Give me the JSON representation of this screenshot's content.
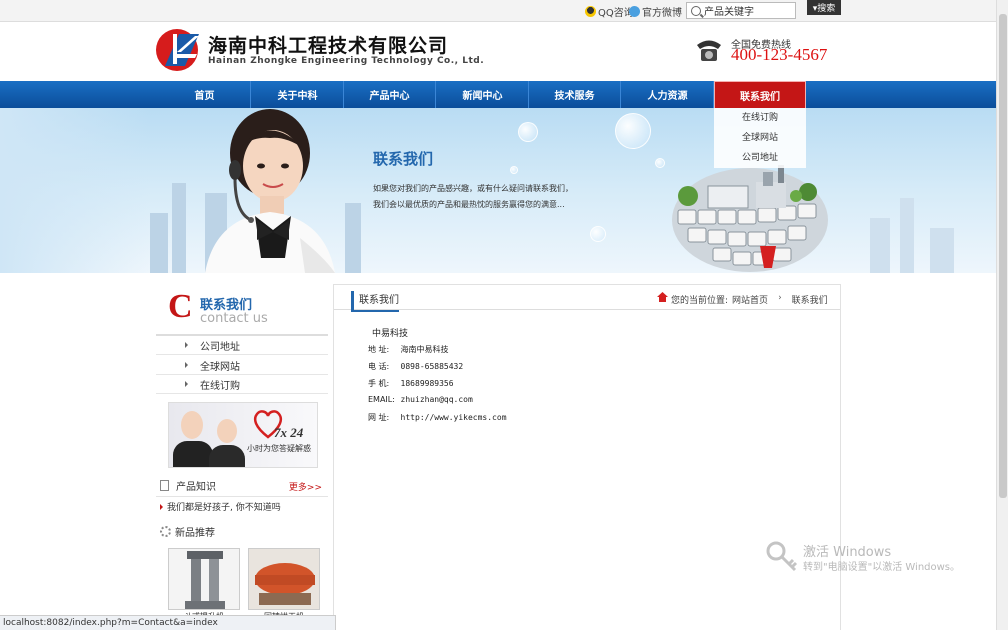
{
  "topbar": {
    "qq_label": "QQ咨询",
    "weibo_label": "官方微博",
    "search_value": "产品关键字",
    "search_button": "▾搜索"
  },
  "header": {
    "title": "海南中科工程技术有限公司",
    "subtitle": "Hainan Zhongke Engineering Technology Co., Ltd.",
    "hotline_label": "全国免费热线",
    "hotline_number": "400-123-4567"
  },
  "nav": {
    "items": [
      "首页",
      "关于中科",
      "产品中心",
      "新闻中心",
      "技术服务",
      "人力资源",
      "联系我们"
    ],
    "active_index": 6,
    "dropdown": [
      "在线订购",
      "全球网站",
      "公司地址"
    ]
  },
  "banner": {
    "title": "联系我们",
    "line1": "如果您对我们的产品感兴趣，或有什么疑问请联系我们，",
    "line2": "我们会以最优质的产品和最热忱的服务赢得您的满意..."
  },
  "sidebar": {
    "letter": "C",
    "title": "联系我们",
    "subtitle": "contact us",
    "items": [
      "公司地址",
      "全球网站",
      "在线订购"
    ],
    "promo_number": "7x 24",
    "promo_text": "小时为您答疑解惑",
    "knowledge_title": "产品知识",
    "more_label": "更多>>",
    "news_item": "我们都是好孩子, 你不知道吗",
    "new_products_title": "新品推荐",
    "products": [
      "斗式提升机",
      "回转烘干机"
    ]
  },
  "content": {
    "title": "联系我们",
    "crumb_label": "您的当前位置:",
    "crumb_home": "网站首页",
    "crumb_current": "联系我们",
    "company": "中易科技",
    "address_label": "地 址:",
    "address_value": "海南中易科技",
    "phone_label": "电 话:",
    "phone_value": "0898-65885432",
    "mobile_label": "手 机:",
    "mobile_value": "18689989356",
    "email_label": "EMAIL:",
    "email_value": "zhuizhan@qq.com",
    "web_label": "网 址:",
    "web_value": "http://www.yikecms.com"
  },
  "statusbar": {
    "url": "localhost:8082/index.php?m=Contact&a=index"
  },
  "watermark": {
    "title": "激活 Windows",
    "subtitle": "转到\"电脑设置\"以激活 Windows。"
  },
  "colors": {
    "nav_blue": "#0b4d9a",
    "nav_active": "#c41616",
    "title_blue": "#2367ad",
    "hotline_red": "#dd1111"
  }
}
